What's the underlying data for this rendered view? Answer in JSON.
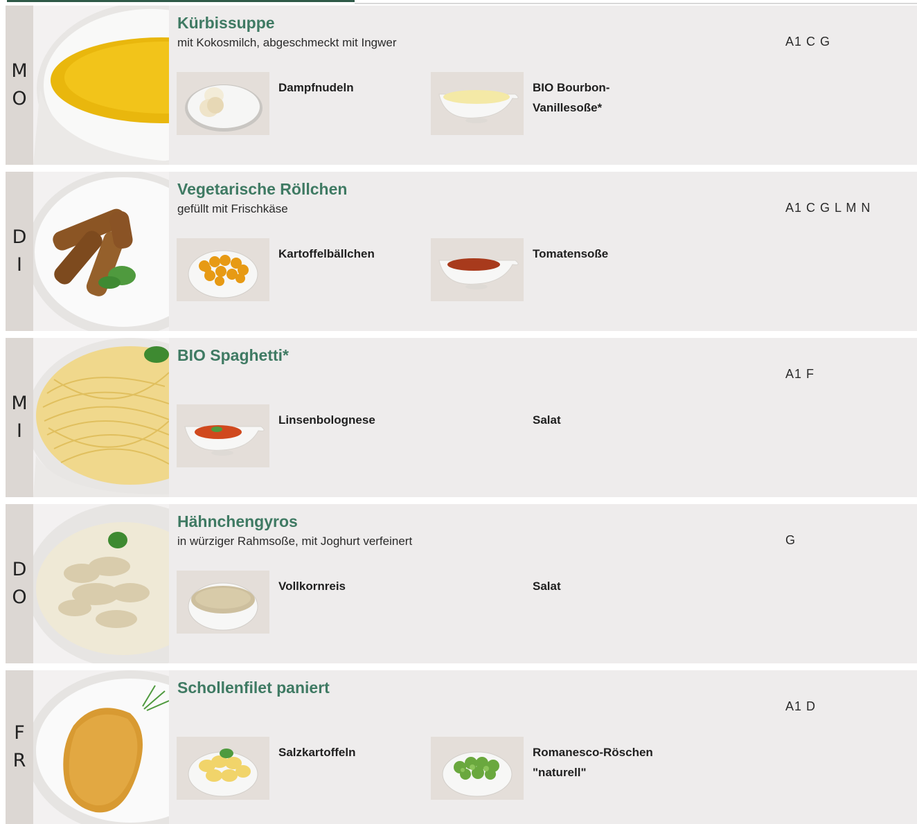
{
  "days": [
    {
      "letters": [
        "M",
        "O"
      ],
      "photo_icon": "pumpkin-soup-bowl",
      "title": "Kürbissuppe",
      "description": "mit Kokosmilch, abgeschmeckt mit Ingwer",
      "allergens": "A1 C G",
      "sides": [
        {
          "label": "Dampfnudeln",
          "icon": "dumplings-plate"
        },
        {
          "label": "BIO Bourbon-Vanillesoße*",
          "label_lines": [
            "BIO Bourbon-",
            "Vanillesoße*"
          ],
          "icon": "vanilla-sauce-boat"
        }
      ]
    },
    {
      "letters": [
        "D",
        "I"
      ],
      "photo_icon": "vegetable-rolls-plate",
      "title": "Vegetarische Röllchen",
      "description": "gefüllt mit Frischkäse",
      "allergens": "A1 C G L M N",
      "sides": [
        {
          "label": "Kartoffelbällchen",
          "icon": "potato-balls-bowl"
        },
        {
          "label": "Tomatensoße",
          "icon": "tomato-sauce-boat"
        }
      ]
    },
    {
      "letters": [
        "M",
        "I"
      ],
      "photo_icon": "spaghetti-bowl",
      "title": "BIO Spaghetti*",
      "description": "",
      "allergens": "A1 F",
      "sides": [
        {
          "label": "Linsenbolognese",
          "icon": "lentil-bolognese-boat"
        },
        {
          "label": "Salat",
          "icon": ""
        }
      ]
    },
    {
      "letters": [
        "D",
        "O"
      ],
      "photo_icon": "chicken-gyros-plate",
      "title": "Hähnchengyros",
      "description": "in würziger Rahmsoße, mit Joghurt verfeinert",
      "allergens": "G",
      "sides": [
        {
          "label": "Vollkornreis",
          "icon": "brown-rice-bowl"
        },
        {
          "label": "Salat",
          "icon": ""
        }
      ]
    },
    {
      "letters": [
        "F",
        "R"
      ],
      "photo_icon": "breaded-plaice-plate",
      "title": "Schollenfilet paniert",
      "description": "",
      "allergens": "A1 D",
      "sides": [
        {
          "label": "Salzkartoffeln",
          "icon": "boiled-potatoes-bowl"
        },
        {
          "label": "Romanesco-Röschen \"naturell\"",
          "label_lines": [
            "Romanesco-Röschen",
            "\"naturell\""
          ],
          "icon": "romanesco-bowl"
        }
      ]
    }
  ],
  "colors": {
    "title_green": "#3f7a63",
    "header_bar": "#2f5a48",
    "row_bg": "#eeecec",
    "day_strip": "#dcd7d3"
  }
}
